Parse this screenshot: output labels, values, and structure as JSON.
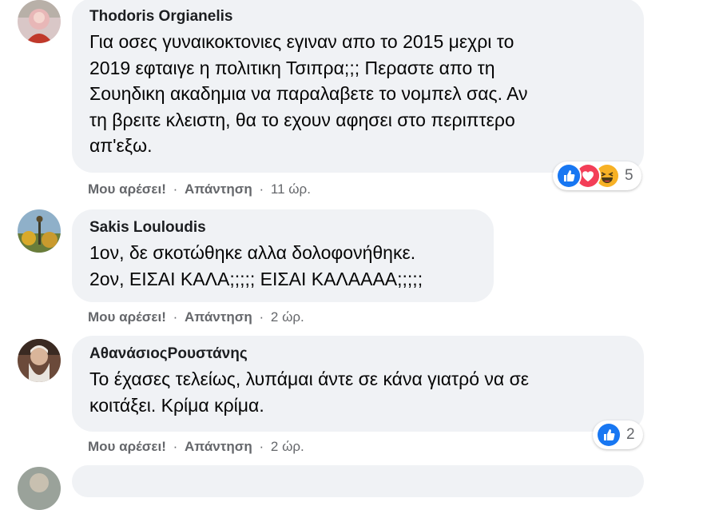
{
  "comments": [
    {
      "author": "Thodoris Orgianelis",
      "text_lines": [
        "Για οσες γυναικοκτονιες εγιναν απο το 2015 μεχρι το",
        "2019 εφταιγε η πολιτικη Τσιπρα;;; Περαστε απο τη",
        "Σουηδικη ακαδημια να παραλαβετε το νομπελ σας. Αν",
        "τη βρειτε κλειστη, θα το εχουν αφησει στο περιπτερο",
        "απ'εξω."
      ],
      "like_label": "Μου αρέσει!",
      "reply_label": "Απάντηση",
      "separator": "·",
      "time": "11 ώρ.",
      "reaction_icons": [
        "like-icon",
        "love-icon",
        "haha-icon"
      ],
      "reaction_count": "5"
    },
    {
      "author": "Sakis Louloudis",
      "text_lines": [
        "1ον, δε σκοτώθηκε αλλα δολοφονήθηκε.",
        "2ον, ΕΙΣΑΙ ΚΑΛΑ;;;;; ΕΙΣΑΙ ΚΑΛΑΑΑΑ;;;;;"
      ],
      "like_label": "Μου αρέσει!",
      "reply_label": "Απάντηση",
      "separator": "·",
      "time": "2 ώρ."
    },
    {
      "author": "ΑθανάσιοςΡουστάνης",
      "text_lines": [
        "Το έχασες τελείως, λυπάμαι άντε σε κάνα γιατρό να σε",
        "κοιτάξει. Κρίμα κρίμα."
      ],
      "like_label": "Μου αρέσει!",
      "reply_label": "Απάντηση",
      "separator": "·",
      "time": "2 ώρ.",
      "reaction_icons": [
        "like-icon"
      ],
      "reaction_count": "2"
    }
  ],
  "colors": {
    "bubble": "#f0f2f5",
    "like_blue": "#1877f2",
    "love_red": "#f33e58",
    "haha_yellow": "#f7b125",
    "meta_gray": "#65676b"
  }
}
